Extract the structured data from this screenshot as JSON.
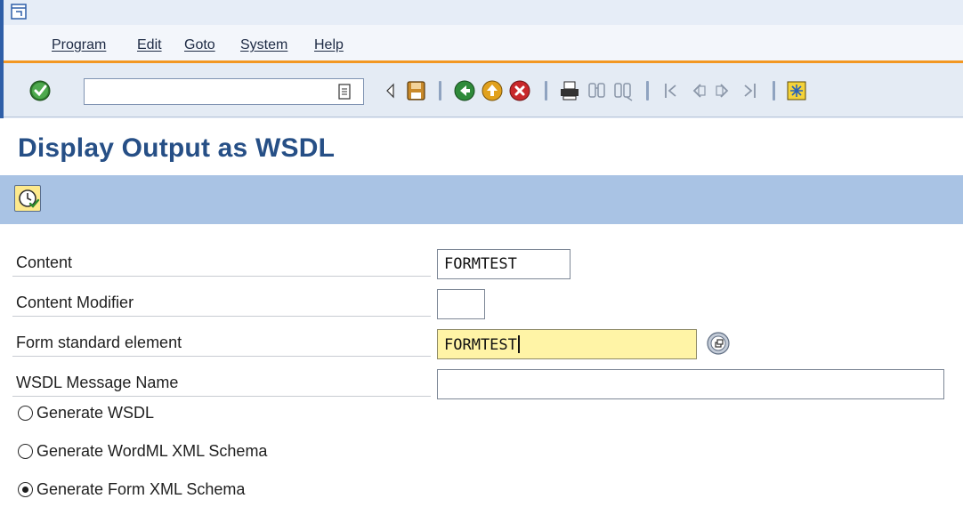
{
  "menu": [
    "Program",
    "Edit",
    "Goto",
    "System",
    "Help"
  ],
  "toolbar": {
    "command_value": "",
    "icons": [
      "ok-icon",
      "command-history-icon",
      "back-arrow-icon",
      "save-icon",
      "back-icon",
      "exit-icon",
      "cancel-icon",
      "print-icon",
      "find-icon",
      "find-next-icon",
      "first-page-icon",
      "previous-page-icon",
      "next-page-icon",
      "last-page-icon",
      "create-session-icon"
    ]
  },
  "page": {
    "title": "Display Output as WSDL"
  },
  "form": {
    "content_label": "Content",
    "content_value": "FORMTEST",
    "modifier_label": "Content Modifier",
    "modifier_value": "",
    "form_label": "Form standard element",
    "form_value": "FORMTEST",
    "message_label": "WSDL Message Name",
    "message_value": "",
    "options": [
      {
        "label": "Generate WSDL",
        "checked": false
      },
      {
        "label": "Generate WordML XML Schema",
        "checked": false
      },
      {
        "label": "Generate Form XML Schema",
        "checked": true
      }
    ]
  },
  "colors": {
    "title": "#264f86",
    "app_toolbar": "#a9c3e4",
    "active_field": "#fff4a6",
    "accent_line": "#f29722"
  }
}
